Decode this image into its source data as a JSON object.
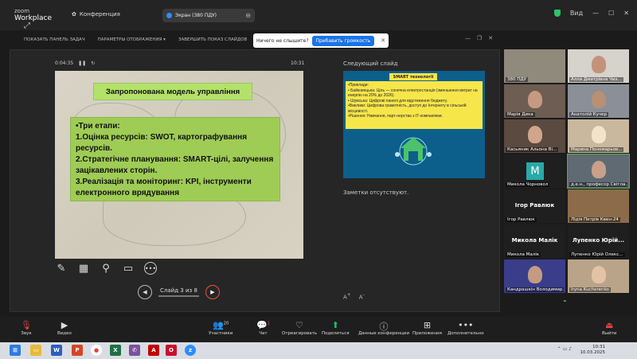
{
  "app": {
    "logo_top": "zoom",
    "logo_bottom": "Workplace",
    "conference_label": "Конференция"
  },
  "screen_tab": {
    "label": "Экран (380 ПДУ)"
  },
  "top_right": {
    "view_label": "Вид"
  },
  "share_toolbar": {
    "items": [
      "ПОКАЗАТЬ ПАНЕЛЬ ЗАДАЧ",
      "ПАРАМЕТРЫ ОТОБРАЖЕНИЯ ▾",
      "ЗАВЕРШИТЬ ПОКАЗ СЛАЙДОВ"
    ]
  },
  "audio_prompt": {
    "text": "Ничего не слышите?",
    "button": "Прибавить громкость"
  },
  "presenter": {
    "elapsed": "0:04:35",
    "clock": "10:31",
    "next_slide_title": "Следующий слайд",
    "notes": "Заметки отсутствуют.",
    "slide_counter": "Слайд 3 из 8"
  },
  "slide": {
    "title": "Запропонована модель управління",
    "lines": [
      "•Три етапи:",
      "1.Оцінка ресурсів: SWOT, картографування ресурсів.",
      "2.Стратегічне планування: SMART-цілі, залучення зацікавлених сторін.",
      "3.Реалізація та моніторинг: KPI, інструменти електронного врядування"
    ]
  },
  "next_slide": {
    "title": "SMART технології",
    "lines": [
      "•Приклади:",
      "• Байковецька: Ціль — сонячна електростанція (зменшення витрат на енергію на 20% до 2026).",
      "• Шумська: Цифрові панелі для відстеження бюджету.",
      "•Виклики: Цифрова грамотність, доступ до Інтернету в сільській місцевості.",
      "•Рішення: Навчання, парт-нерства з IT-компаніями."
    ]
  },
  "participants": [
    {
      "name": "380 ПДУ",
      "kind": "video",
      "bg": "#8f8a7c"
    },
    {
      "name": "Алла Дмитрівна Чих...",
      "kind": "video",
      "bg": "#8a94a3"
    },
    {
      "name": "Марія Дика",
      "kind": "video",
      "bg": "#6d5d52"
    },
    {
      "name": "Анатолій Кучер",
      "kind": "video",
      "bg": "#8a8f98"
    },
    {
      "name": "Касьяник Альона Ві...",
      "kind": "video",
      "bg": "#5a4a40"
    },
    {
      "name": "Марина Пономарьов...",
      "kind": "video",
      "bg": "#c9b89e"
    },
    {
      "name": "Микола Чорновол",
      "kind": "avatar",
      "initial": "M",
      "bg": "#1f1f1f"
    },
    {
      "name": "д.е.н., професор Світла...",
      "kind": "video",
      "bg": "#5f6a72"
    },
    {
      "name": "Ігор Равлюк",
      "kind": "name",
      "center": "Ігор Равлюк",
      "bg": "#1f1f1f"
    },
    {
      "name": "Лідія Петрів Квен-24",
      "kind": "video",
      "bg": "#8b6b4a"
    },
    {
      "name": "Микола Малік",
      "kind": "name",
      "center": "Микола Малік",
      "bg": "#1f1f1f"
    },
    {
      "name": "Лупенко Юрій Олекс...",
      "kind": "name",
      "center": "Лупенко Юрій...",
      "bg": "#1f1f1f"
    },
    {
      "name": "Кандрашкін Володимир...",
      "kind": "video",
      "bg": "#3a3d8a"
    },
    {
      "name": "Iryna Kucherenko",
      "kind": "video",
      "bg": "#b9a48a"
    }
  ],
  "bottom_toolbar": {
    "items": [
      "Звук",
      "Видео",
      "Участники",
      "Чат",
      "Отреагировать",
      "Поделиться",
      "Данные конференции",
      "Приложения",
      "Дополнительно"
    ],
    "participant_count": "20",
    "chat_badge": "1",
    "exit_label": "Выйти"
  },
  "taskbar": {
    "time": "10:31",
    "date": "10.03.2025"
  }
}
